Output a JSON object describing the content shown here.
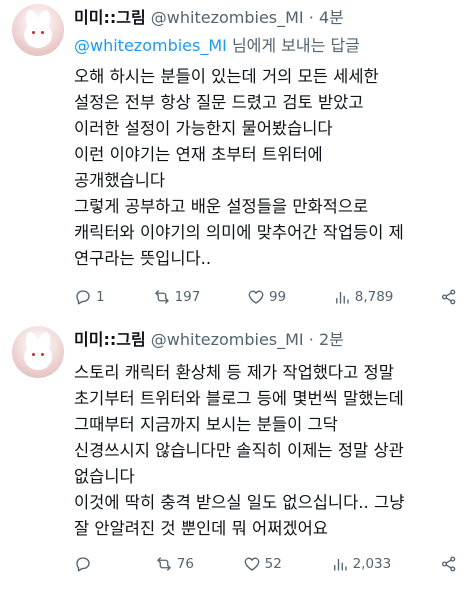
{
  "tweet1": {
    "author": "미미::그림",
    "handle": "@whitezombies_MI",
    "separator": "·",
    "time": "4분",
    "reply_to_mention": "@whitezombies_MI",
    "reply_suffix": " 님에게 보내는 답글",
    "body_lines": [
      "오해 하시는 분들이 있는데 거의 모든 세세한",
      "설정은 전부 항상 질문 드렸고 검토 받았고",
      "이러한 설정이 가능한지 물어봤습니다",
      "이런 이야기는 연재 초부터 트위터에",
      "공개했습니다",
      "그렇게 공부하고 배운 설정들을 만화적으로",
      "캐릭터와 이야기의 의미에 맞추어간 작업등이 제",
      "연구라는 뜻입니다.."
    ],
    "stats": {
      "replies": "1",
      "retweets": "197",
      "likes": "99",
      "views": "8,789"
    }
  },
  "tweet2": {
    "author": "미미::그림",
    "handle": "@whitezombies_MI",
    "separator": "·",
    "time": "2분",
    "body_lines": [
      "스토리 캐릭터 환상체 등 제가 작업했다고 정말",
      "초기부터 트위터와 블로그 등에 몇번씩 말했는데",
      "그때부터 지금까지 보시는 분들이 그닥",
      "신경쓰시지 않습니다만 솔직히 이제는 정말 상관",
      "없습니다",
      "이것에 딱히 충격 받으실 일도 없으십니다.. 그냥",
      "잘 안알려진 것 뿐인데 뭐 어쩌겠어요"
    ],
    "stats": {
      "replies": "",
      "retweets": "76",
      "likes": "52",
      "views": "2,033"
    }
  },
  "icons": [
    "reply-icon",
    "retweet-icon",
    "like-icon",
    "views-icon",
    "share-icon"
  ],
  "colors": {
    "link": "#1d9bf0",
    "secondary": "#536471",
    "text": "#0f1419"
  }
}
